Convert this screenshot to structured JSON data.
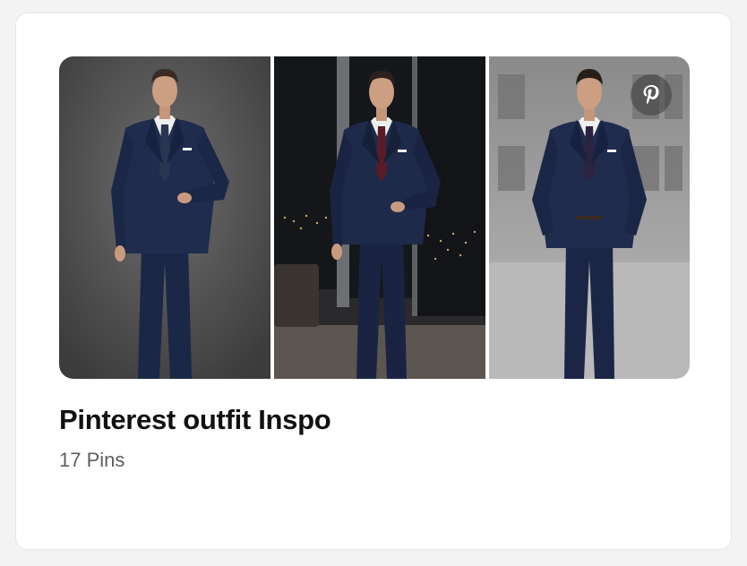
{
  "board": {
    "title": "Pinterest outfit Inspo",
    "pin_count": "17 Pins"
  },
  "images": [
    {
      "name": "man in navy suit against dark grey backdrop"
    },
    {
      "name": "man in navy suit in office with city night view"
    },
    {
      "name": "man in navy suit on city street"
    }
  ],
  "brand_icon": "pinterest-icon",
  "colors": {
    "suit": "#1d2a4a",
    "tie_navy": "#2a3552",
    "tie_burgundy": "#5a1c26",
    "card_bg": "#ffffff",
    "title": "#111111",
    "subtitle": "#5f5f5f"
  }
}
